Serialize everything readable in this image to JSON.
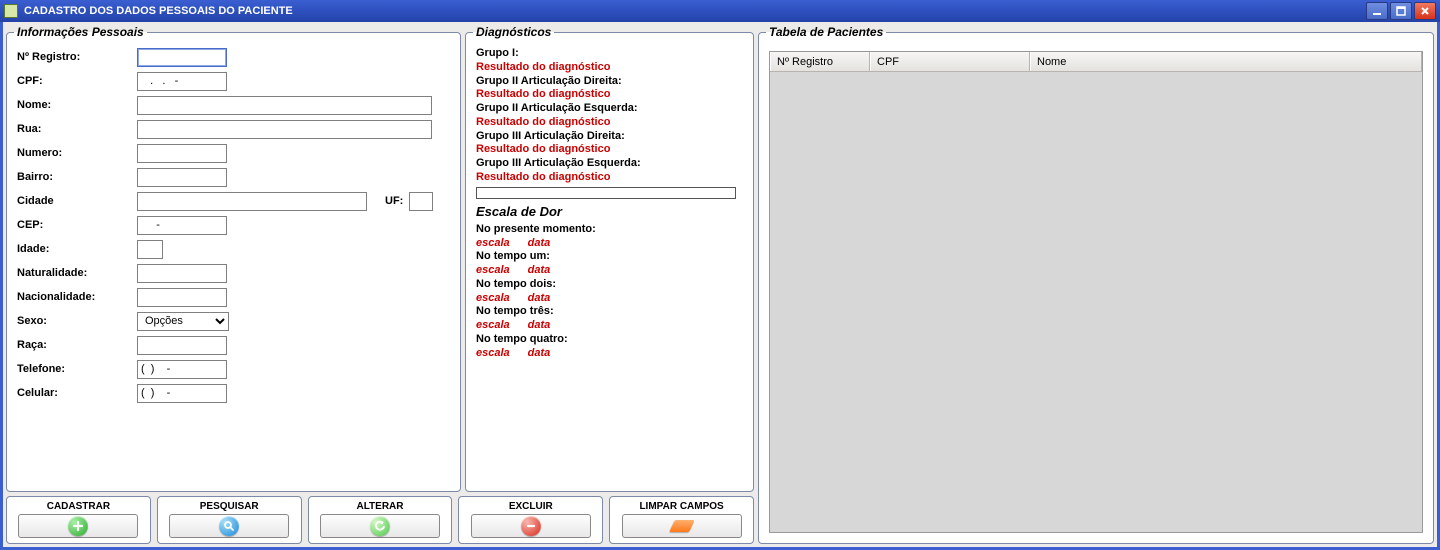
{
  "window": {
    "title": "CADASTRO DOS DADOS PESSOAIS DO PACIENTE"
  },
  "panels": {
    "info_title": "Informações Pessoais",
    "diag_title": "Diagnósticos",
    "table_title": "Tabela de Pacientes"
  },
  "form": {
    "registro_label": "Nº Registro:",
    "registro_value": "",
    "cpf_label": "CPF:",
    "cpf_value": "   .   .   -",
    "nome_label": "Nome:",
    "nome_value": "",
    "rua_label": "Rua:",
    "rua_value": "",
    "numero_label": "Numero:",
    "numero_value": "",
    "bairro_label": "Bairro:",
    "bairro_value": "",
    "cidade_label": "Cidade",
    "cidade_value": "",
    "uf_label": "UF:",
    "uf_value": "",
    "cep_label": "CEP:",
    "cep_value": "     -",
    "idade_label": "Idade:",
    "idade_value": "",
    "naturalidade_label": "Naturalidade:",
    "naturalidade_value": "",
    "nacionalidade_label": "Nacionalidade:",
    "nacionalidade_value": "",
    "sexo_label": "Sexo:",
    "sexo_value": "Opções",
    "raca_label": "Raça:",
    "raca_value": "",
    "telefone_label": "Telefone:",
    "telefone_value": "(  )    -",
    "celular_label": "Celular:",
    "celular_value": "(  )    -"
  },
  "diag": {
    "g1_label": "Grupo I:",
    "g1_result": "Resultado do diagnóstico",
    "g2d_label": "Grupo II Articulação Direita:",
    "g2d_result": "Resultado do diagnóstico",
    "g2e_label": "Grupo II Articulação Esquerda:",
    "g2e_result": "Resultado do diagnóstico",
    "g3d_label": "Grupo III Articulação Direita:",
    "g3d_result": "Resultado do diagnóstico",
    "g3e_label": "Grupo III Articulação Esquerda:",
    "g3e_result": "Resultado do diagnóstico"
  },
  "dor": {
    "title": "Escala  de Dor",
    "t0_label": "No presente momento:",
    "t1_label": "No tempo um:",
    "t2_label": "No tempo dois:",
    "t3_label": "No tempo três:",
    "t4_label": "No tempo quatro:",
    "escala": "escala",
    "data": "data"
  },
  "actions": {
    "cadastrar": "CADASTRAR",
    "pesquisar": "PESQUISAR",
    "alterar": "ALTERAR",
    "excluir": "EXCLUIR",
    "limpar": "LIMPAR CAMPOS"
  },
  "table": {
    "cols": {
      "registro": "Nº Registro",
      "cpf": "CPF",
      "nome": "Nome"
    },
    "rows": []
  }
}
